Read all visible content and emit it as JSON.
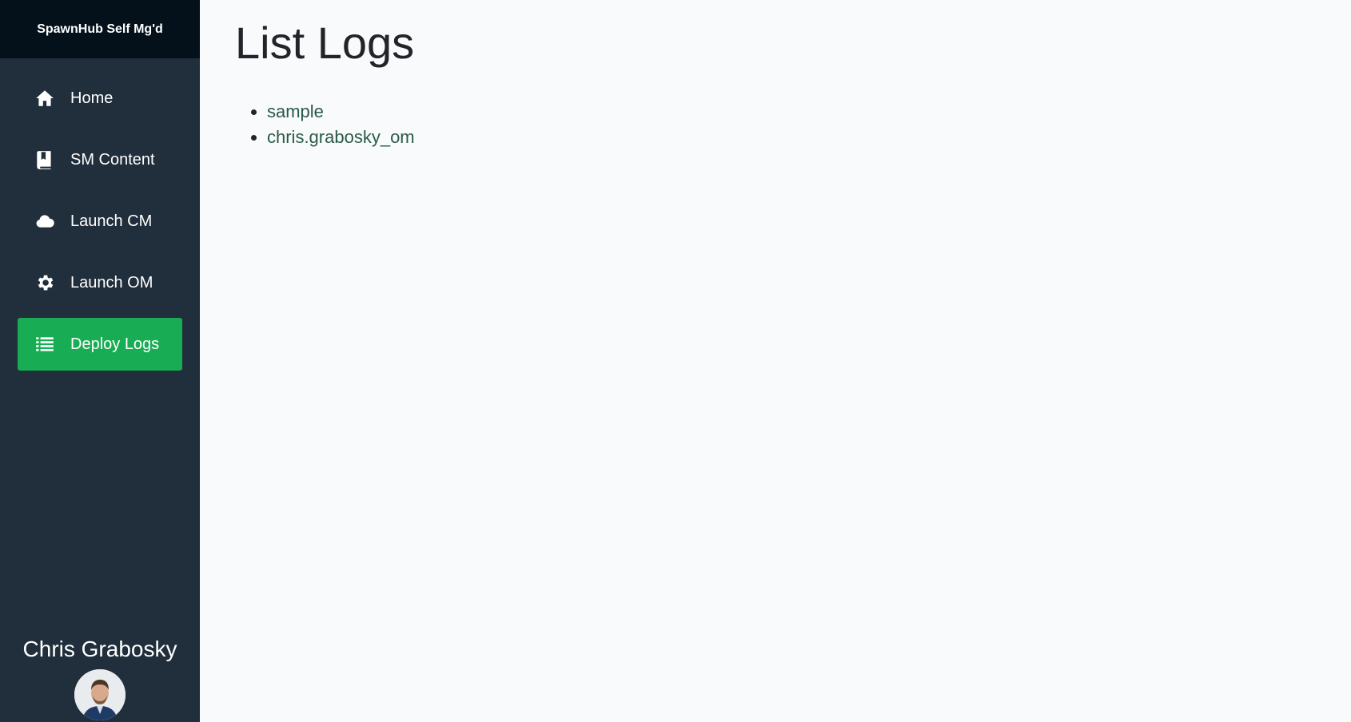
{
  "sidebar": {
    "brand": "SpawnHub Self Mg'd",
    "items": [
      {
        "label": "Home",
        "icon": "home-icon"
      },
      {
        "label": "SM Content",
        "icon": "book-icon"
      },
      {
        "label": "Launch CM",
        "icon": "cloud-icon"
      },
      {
        "label": "Launch OM",
        "icon": "gear-icon"
      },
      {
        "label": "Deploy Logs",
        "icon": "list-icon",
        "active": true
      }
    ],
    "user": {
      "name": "Chris Grabosky"
    }
  },
  "main": {
    "title": "List Logs",
    "logs": [
      "sample",
      "chris.grabosky_om"
    ]
  },
  "colors": {
    "sidebar_bg": "#212f3c",
    "brand_bg": "#05111a",
    "active_bg": "#18ad54",
    "link": "#2a5a47"
  }
}
